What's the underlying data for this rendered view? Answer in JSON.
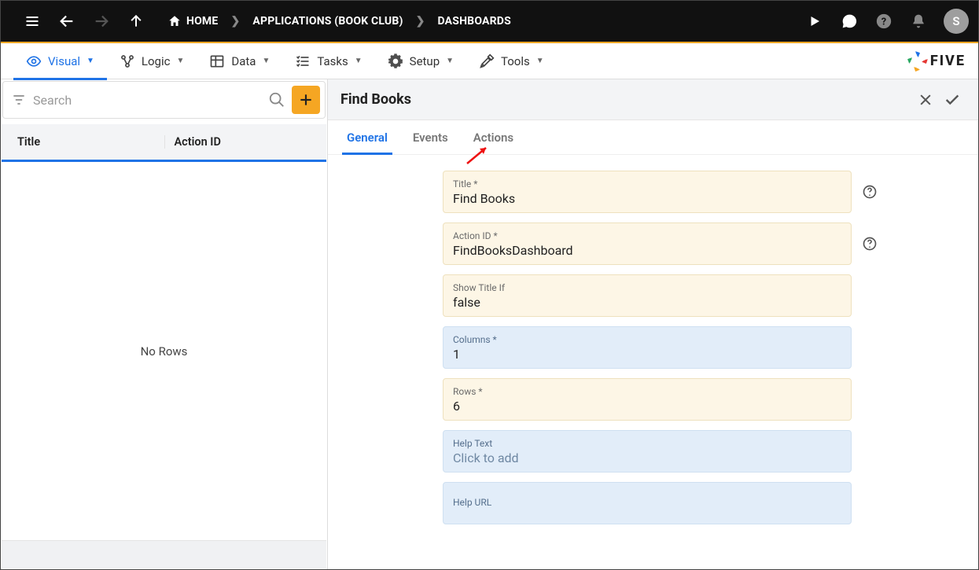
{
  "topbar": {
    "home_label": "HOME",
    "breadcrumb1": "APPLICATIONS (BOOK CLUB)",
    "breadcrumb2": "DASHBOARDS",
    "avatar_letter": "S"
  },
  "secnav": {
    "visual": "Visual",
    "logic": "Logic",
    "data": "Data",
    "tasks": "Tasks",
    "setup": "Setup",
    "tools": "Tools",
    "brand": "FIVE"
  },
  "left": {
    "search_placeholder": "Search",
    "col_title": "Title",
    "col_actionid": "Action ID",
    "no_rows": "No Rows"
  },
  "right": {
    "title": "Find Books",
    "tabs": {
      "general": "General",
      "events": "Events",
      "actions": "Actions"
    },
    "fields": {
      "title_label": "Title *",
      "title_value": "Find Books",
      "actionid_label": "Action ID *",
      "actionid_value": "FindBooksDashboard",
      "showtitle_label": "Show Title If",
      "showtitle_value": "false",
      "columns_label": "Columns *",
      "columns_value": "1",
      "rows_label": "Rows *",
      "rows_value": "6",
      "helptext_label": "Help Text",
      "helptext_value": "Click to add",
      "helpurl_label": "Help URL",
      "helpurl_value": ""
    }
  }
}
